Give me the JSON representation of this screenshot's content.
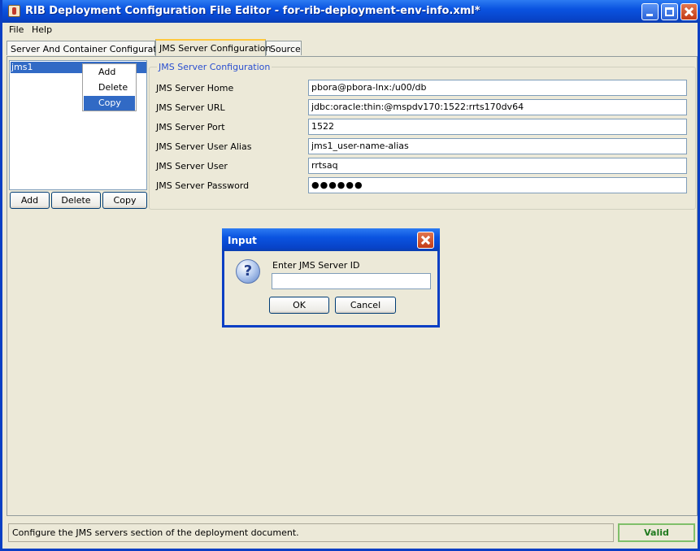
{
  "window": {
    "title": "RIB Deployment Configuration File Editor - for-rib-deployment-env-info.xml*"
  },
  "menu": [
    "File",
    "Help"
  ],
  "tabs": [
    {
      "label": "Server And Container Configuration"
    },
    {
      "label": "JMS Server Configuration"
    },
    {
      "label": "Source"
    }
  ],
  "server_list": {
    "items": [
      "jms1"
    ]
  },
  "list_buttons": {
    "add": "Add",
    "delete": "Delete",
    "copy": "Copy"
  },
  "context_menu": {
    "items": [
      "Add",
      "Delete",
      "Copy"
    ],
    "highlighted": "Copy"
  },
  "jms_config": {
    "section_title": "JMS Server Configuration",
    "fields": [
      {
        "label": "JMS Server Home",
        "value": "pbora@pbora-lnx:/u00/db"
      },
      {
        "label": "JMS Server URL",
        "value": "jdbc:oracle:thin:@mspdv170:1522:rrts170dv64"
      },
      {
        "label": "JMS Server Port",
        "value": "1522"
      },
      {
        "label": "JMS Server User Alias",
        "value": "jms1_user-name-alias"
      },
      {
        "label": "JMS Server User",
        "value": "rrtsaq"
      },
      {
        "label": "JMS Server Password",
        "value": "●●●●●●"
      }
    ]
  },
  "dialog": {
    "title": "Input",
    "prompt": "Enter JMS Server ID",
    "input_value": "",
    "ok_label": "OK",
    "cancel_label": "Cancel"
  },
  "status": {
    "message": "Configure the JMS servers section of the deployment document.",
    "validity": "Valid"
  },
  "colors": {
    "titlebar": "#0a53e0",
    "selection": "#316ac5",
    "valid_text": "#1f7a1f",
    "section_title": "#2a4fd0"
  }
}
